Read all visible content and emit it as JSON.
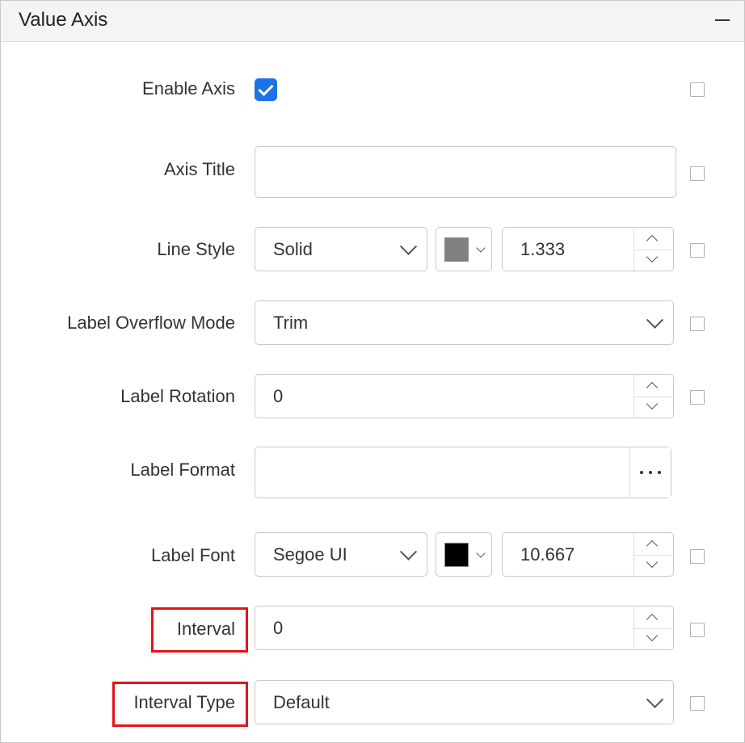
{
  "section": {
    "title": "Value Axis"
  },
  "fields": {
    "enable_axis": {
      "label": "Enable Axis",
      "checked": true
    },
    "axis_title": {
      "label": "Axis Title",
      "value": ""
    },
    "line_style": {
      "label": "Line Style",
      "style": "Solid",
      "color": "#808080",
      "width": "1.333"
    },
    "label_overflow_mode": {
      "label": "Label Overflow Mode",
      "value": "Trim"
    },
    "label_rotation": {
      "label": "Label Rotation",
      "value": "0"
    },
    "label_format": {
      "label": "Label Format",
      "value": ""
    },
    "label_font": {
      "label": "Label Font",
      "family": "Segoe UI",
      "color": "#000000",
      "size": "10.667"
    },
    "interval": {
      "label": "Interval",
      "value": "0"
    },
    "interval_type": {
      "label": "Interval Type",
      "value": "Default"
    }
  },
  "icons": {
    "collapse": "minus-icon",
    "dropdown": "chevron-down-icon",
    "spin_up": "chevron-up-icon",
    "spin_down": "chevron-down-icon",
    "more": "ellipsis-icon"
  },
  "colors": {
    "accent": "#1a73e8",
    "highlight": "#e0151a"
  }
}
